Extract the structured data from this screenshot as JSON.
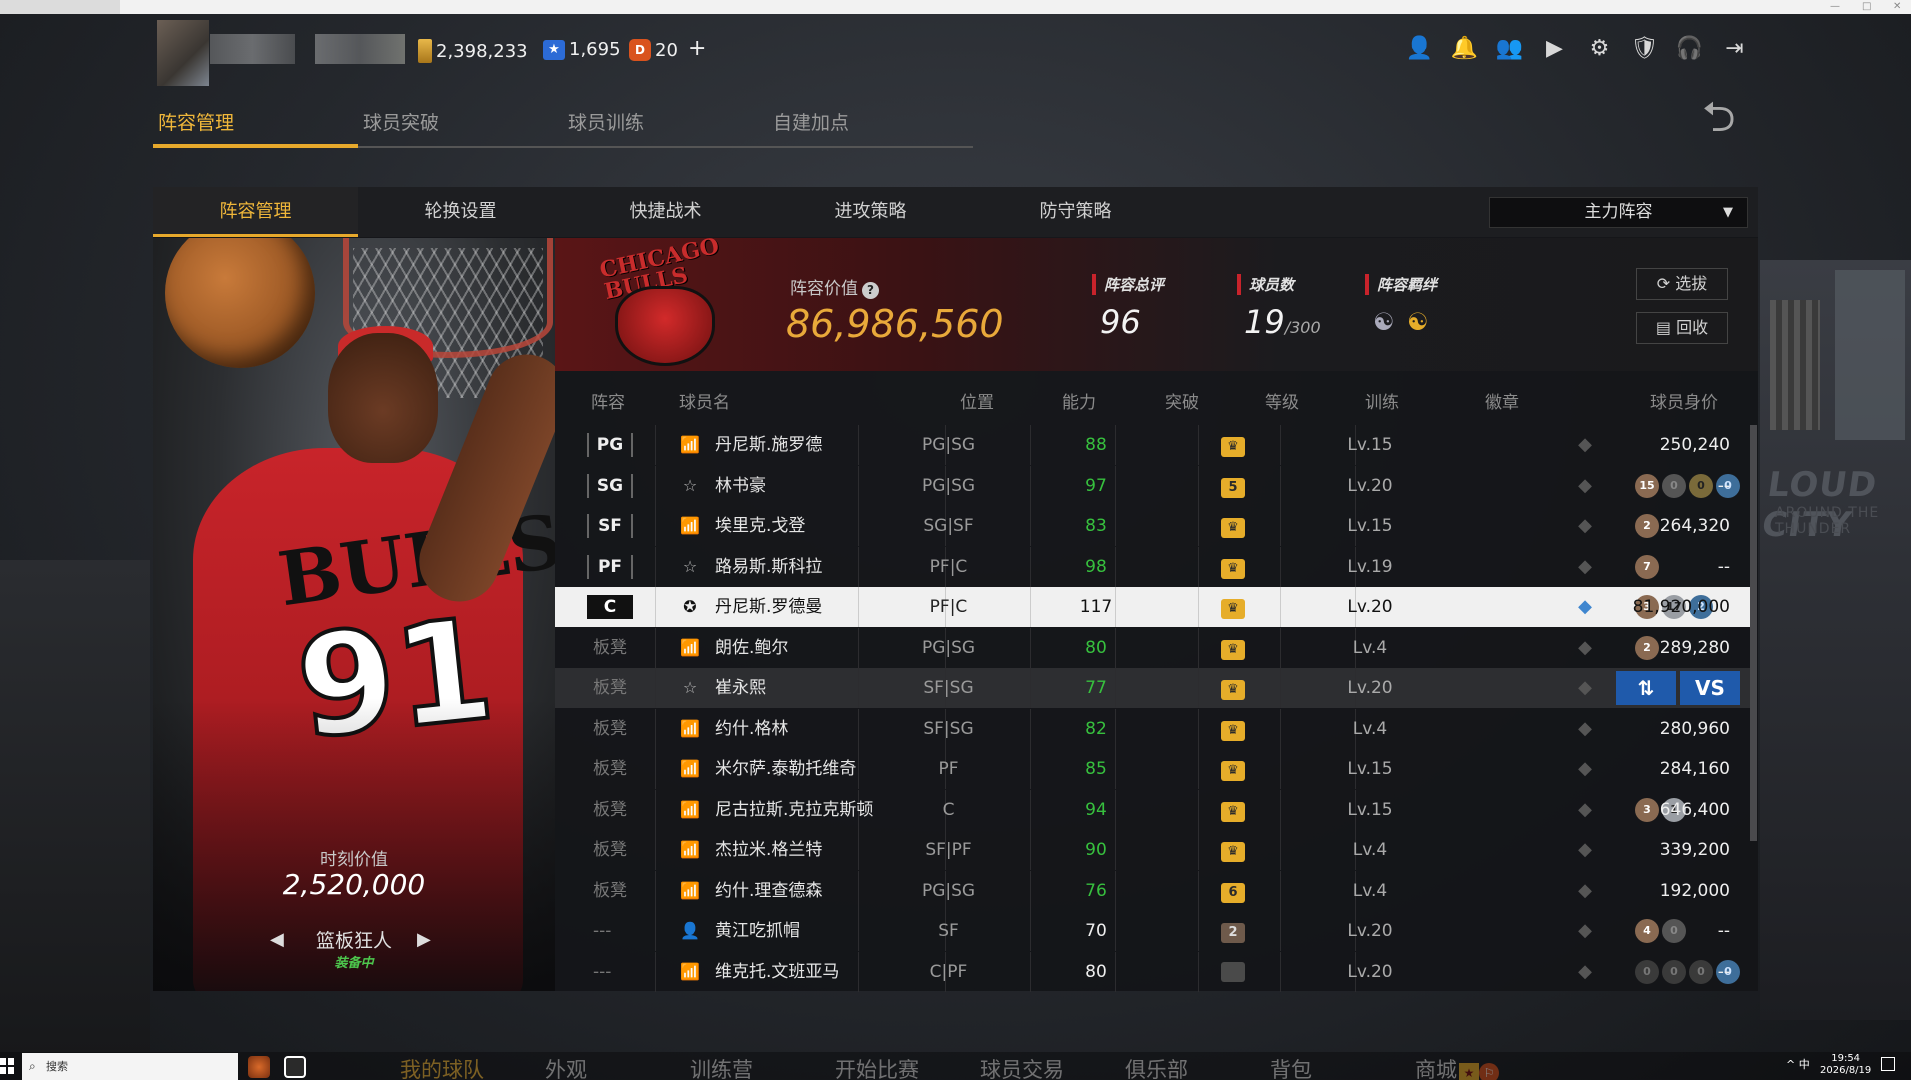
{
  "header": {
    "gold": "2,398,233",
    "stars": "1,695",
    "coins": "20",
    "plus": "+",
    "icons": [
      "profile-icon",
      "bell-icon",
      "friends-icon",
      "video-icon",
      "gear-icon",
      "shield-icon",
      "headset-icon",
      "exit-icon"
    ]
  },
  "top_tabs": [
    "阵容管理",
    "球员突破",
    "球员训练",
    "自建加点"
  ],
  "sub_tabs": [
    "阵容管理",
    "轮换设置",
    "快捷战术",
    "进攻策略",
    "防守策略"
  ],
  "lineup_select": "主力阵容",
  "banner": {
    "team_logo_text": "CHICAGO BULLS",
    "value_label": "阵容价值",
    "value": "86,986,560",
    "overall_label": "阵容总评",
    "overall": "96",
    "count_label": "球员数",
    "count": "19",
    "count_max": "/300",
    "bond_label": "阵容羁绊",
    "select_btn": "选拔",
    "recycle_btn": "回收"
  },
  "player_card": {
    "value_label": "时刻价值",
    "value": "2,520,000",
    "card_name": "篮板狂人",
    "equipped": "装备中",
    "jersey_word": "BULLS",
    "jersey_num": "91"
  },
  "table": {
    "headers": [
      "阵容",
      "球员名",
      "位置",
      "能力",
      "突破",
      "等级",
      "训练",
      "徽章",
      "球员身价"
    ],
    "rows": [
      {
        "slot": "PG",
        "bench": false,
        "kind": "bar",
        "name": "丹尼斯.施罗德",
        "pos": "PG|SG",
        "rating": "88",
        "rating_color": "green",
        "breakthrough": "♛",
        "bt_style": "gold",
        "level": "Lv.15",
        "train": "dim",
        "badges": [],
        "price": "250,240"
      },
      {
        "slot": "SG",
        "bench": false,
        "kind": "star",
        "name": "林书豪",
        "pos": "PG|SG",
        "rating": "97",
        "rating_color": "green",
        "breakthrough": "5",
        "bt_style": "gold",
        "level": "Lv.20",
        "train": "dim",
        "badges": [
          [
            "15",
            "b-bronze"
          ],
          [
            "0",
            "b-gray"
          ],
          [
            "0",
            "b-gold"
          ],
          [
            "0",
            "b-blue"
          ]
        ],
        "price": "--"
      },
      {
        "slot": "SF",
        "bench": false,
        "kind": "bar",
        "name": "埃里克.戈登",
        "pos": "SG|SF",
        "rating": "83",
        "rating_color": "green",
        "breakthrough": "♛",
        "bt_style": "gold",
        "level": "Lv.15",
        "train": "dim",
        "badges": [
          [
            "2",
            "b-bronze"
          ]
        ],
        "price": "264,320"
      },
      {
        "slot": "PF",
        "bench": false,
        "kind": "star",
        "name": "路易斯.斯科拉",
        "pos": "PF|C",
        "rating": "98",
        "rating_color": "green",
        "breakthrough": "♛",
        "bt_style": "gold",
        "level": "Lv.19",
        "train": "dim",
        "badges": [
          [
            "7",
            "b-bronze"
          ]
        ],
        "price": "--"
      },
      {
        "slot": "C",
        "bench": false,
        "kind": "star95",
        "name": "丹尼斯.罗德曼",
        "pos": "PF|C",
        "rating": "117",
        "rating_color": "white",
        "breakthrough": "♛",
        "bt_style": "gold",
        "level": "Lv.20",
        "train": "active",
        "badges": [
          [
            "3",
            "b-bronze"
          ],
          [
            "17",
            "b-silver"
          ],
          [
            "2",
            "b-blue"
          ]
        ],
        "price": "81,920,000",
        "selected": true
      },
      {
        "slot": "板凳",
        "bench": true,
        "kind": "bar",
        "name": "朗佐.鲍尔",
        "pos": "PG|SG",
        "rating": "80",
        "rating_color": "green",
        "breakthrough": "♛",
        "bt_style": "gold",
        "level": "Lv.4",
        "train": "dim",
        "badges": [
          [
            "2",
            "b-bronze"
          ]
        ],
        "price": "289,280"
      },
      {
        "slot": "板凳",
        "bench": true,
        "kind": "star",
        "name": "崔永熙",
        "pos": "SF|SG",
        "rating": "77",
        "rating_color": "green",
        "breakthrough": "♛",
        "bt_style": "gold",
        "level": "Lv.20",
        "train": "dim",
        "badges": [],
        "price": "",
        "hover": true,
        "btn_swap": "⇅",
        "btn_vs": "VS"
      },
      {
        "slot": "板凳",
        "bench": true,
        "kind": "bar",
        "name": "约什.格林",
        "pos": "SF|SG",
        "rating": "82",
        "rating_color": "green",
        "breakthrough": "♛",
        "bt_style": "gold",
        "level": "Lv.4",
        "train": "dim",
        "badges": [],
        "price": "280,960"
      },
      {
        "slot": "板凳",
        "bench": true,
        "kind": "bar",
        "name": "米尔萨.泰勒托维奇",
        "pos": "PF",
        "rating": "85",
        "rating_color": "green",
        "breakthrough": "♛",
        "bt_style": "gold",
        "level": "Lv.15",
        "train": "dim",
        "badges": [],
        "price": "284,160"
      },
      {
        "slot": "板凳",
        "bench": true,
        "kind": "bar",
        "name": "尼古拉斯.克拉克斯顿",
        "pos": "C",
        "rating": "94",
        "rating_color": "green",
        "breakthrough": "♛",
        "bt_style": "gold",
        "level": "Lv.15",
        "train": "dim",
        "badges": [
          [
            "3",
            "b-bronze"
          ],
          [
            "1",
            "b-silver"
          ]
        ],
        "price": "646,400"
      },
      {
        "slot": "板凳",
        "bench": true,
        "kind": "bar",
        "name": "杰拉米.格兰特",
        "pos": "SF|PF",
        "rating": "90",
        "rating_color": "green",
        "breakthrough": "♛",
        "bt_style": "gold",
        "level": "Lv.4",
        "train": "dim",
        "badges": [],
        "price": "339,200"
      },
      {
        "slot": "板凳",
        "bench": true,
        "kind": "bar",
        "name": "约什.理查德森",
        "pos": "PG|SG",
        "rating": "76",
        "rating_color": "green",
        "breakthrough": "6",
        "bt_style": "gold",
        "level": "Lv.4",
        "train": "dim",
        "badges": [],
        "price": "192,000"
      },
      {
        "slot": "---",
        "bench": true,
        "kind": "person",
        "name": "黄江吃抓帽",
        "pos": "SF",
        "rating": "70",
        "rating_color": "white",
        "breakthrough": "2",
        "bt_style": "grey",
        "level": "Lv.20",
        "train": "dim",
        "badges": [
          [
            "4",
            "b-bronze"
          ],
          [
            "0",
            "b-gray"
          ]
        ],
        "price": "--"
      },
      {
        "slot": "---",
        "bench": true,
        "kind": "bar",
        "name": "维克托.文班亚马",
        "pos": "C|PF",
        "rating": "80",
        "rating_color": "white",
        "breakthrough": "",
        "bt_style": "dim",
        "level": "Lv.20",
        "train": "dim",
        "badges": [
          [
            "0",
            "b-dark"
          ],
          [
            "0",
            "b-dark"
          ],
          [
            "0",
            "b-dark"
          ],
          [
            "0",
            "b-blue"
          ]
        ],
        "price": "--"
      }
    ]
  },
  "bottom_nav": [
    "我的球队",
    "外观",
    "训练营",
    "开始比赛",
    "球员交易",
    "俱乐部",
    "背包",
    "商城"
  ],
  "taskbar": {
    "search_placeholder": "搜索",
    "tray": "^ 中",
    "time": "19:54",
    "date": "2026/8/19"
  },
  "colors": {
    "accent": "#e7a92c",
    "green": "#37c03e",
    "selected_row": "#f0f0f0",
    "bulls_red": "#c8232b",
    "action_blue": "#1f5aab"
  }
}
